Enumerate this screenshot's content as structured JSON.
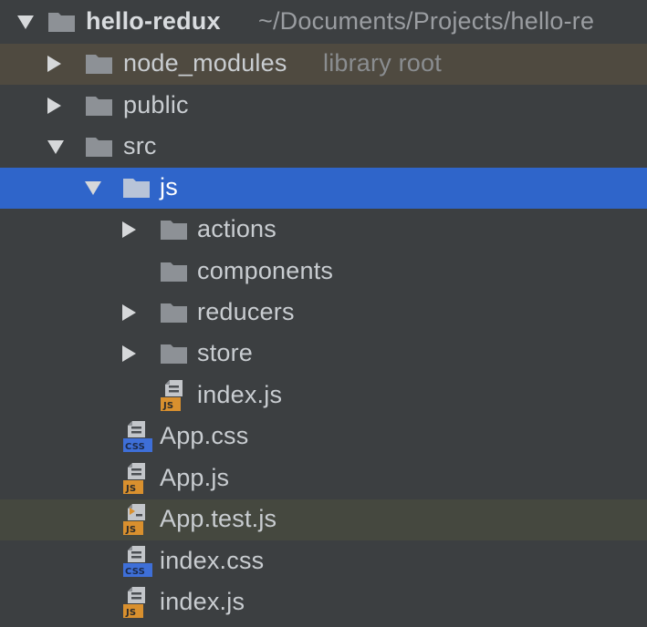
{
  "project": {
    "name": "hello-redux",
    "path": "~/Documents/Projects/hello-re"
  },
  "nodes": [
    {
      "label": "node_modules",
      "hint": "library root"
    },
    {
      "label": "public"
    },
    {
      "label": "src"
    },
    {
      "label": "js"
    },
    {
      "label": "actions"
    },
    {
      "label": "components"
    },
    {
      "label": "reducers"
    },
    {
      "label": "store"
    },
    {
      "label": "index.js",
      "badge": "JS"
    },
    {
      "label": "App.css",
      "badge": "CSS"
    },
    {
      "label": "App.js",
      "badge": "JS"
    },
    {
      "label": "App.test.js",
      "badge": "JS"
    },
    {
      "label": "index.css",
      "badge": "CSS"
    },
    {
      "label": "index.js",
      "badge": "JS"
    }
  ],
  "colors": {
    "background": "#3c3f41",
    "selection": "#2f65ca",
    "library_root_row": "#4f4a40",
    "test_file_row": "#45483f",
    "js_badge": "#d9902e",
    "css_badge": "#3e6fd8"
  }
}
